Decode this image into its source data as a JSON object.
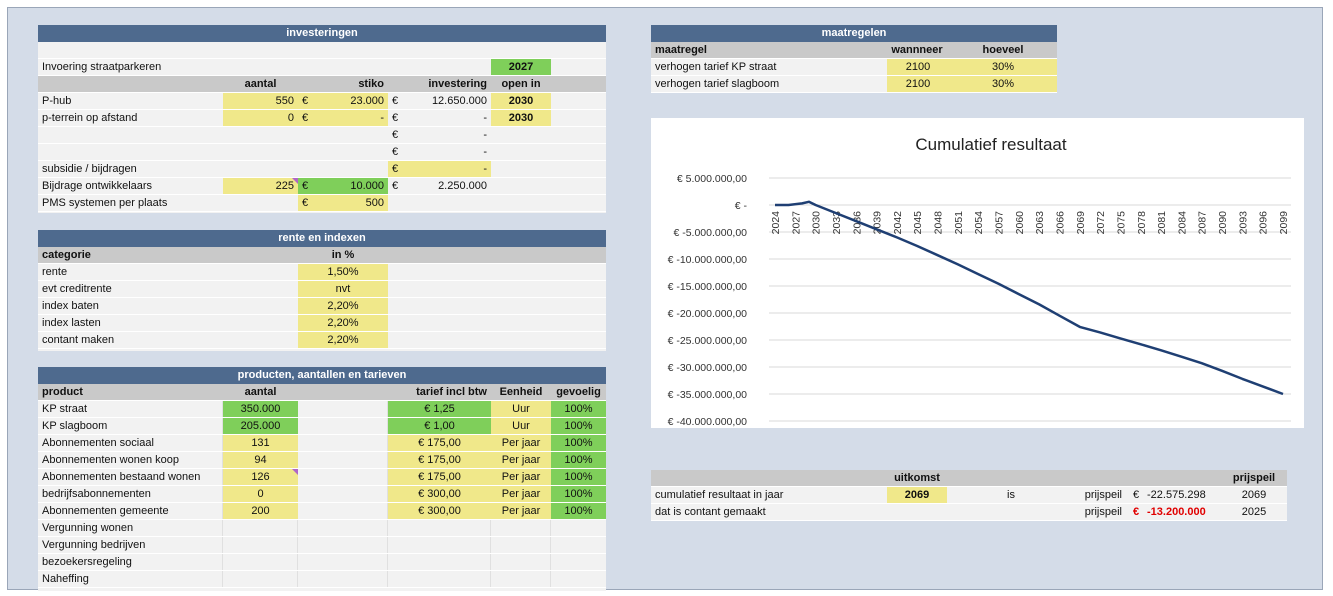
{
  "investeringen": {
    "title": "investeringen",
    "invoering_label": "Invoering straatparkeren",
    "invoering_year": "2027",
    "headers": [
      "aantal",
      "stiko",
      "investering",
      "open in"
    ],
    "rows": [
      {
        "label": "P-hub",
        "aantal": "550",
        "cur1": "€",
        "stiko": "23.000",
        "cur2": "€",
        "investering": "12.650.000",
        "open": "2030"
      },
      {
        "label": "p-terrein op afstand",
        "aantal": "0",
        "cur1": "€",
        "stiko": "-",
        "cur2": "€",
        "investering": "-",
        "open": "2030"
      },
      {
        "label": "",
        "cur2": "€",
        "investering": "-"
      },
      {
        "label": "",
        "cur2": "€",
        "investering": "-"
      },
      {
        "label": "subsidie / bijdragen",
        "cur2": "€",
        "investering": "-"
      },
      {
        "label": "Bijdrage ontwikkelaars",
        "aantal": "225",
        "cur1": "€",
        "stiko": "10.000",
        "cur2": "€",
        "investering": "2.250.000"
      },
      {
        "label": "PMS systemen per plaats",
        "cur1": "€",
        "stiko": "500"
      }
    ]
  },
  "rente": {
    "title": "rente en indexen",
    "headers": [
      "categorie",
      "in %"
    ],
    "rows": [
      {
        "label": "rente",
        "value": "1,50%"
      },
      {
        "label": "evt creditrente",
        "value": "nvt"
      },
      {
        "label": "index baten",
        "value": "2,20%"
      },
      {
        "label": "index lasten",
        "value": "2,20%"
      },
      {
        "label": "contant maken",
        "value": "2,20%"
      }
    ]
  },
  "producten": {
    "title": "producten, aantallen en tarieven",
    "headers": [
      "product",
      "aantal",
      "tarief incl btw",
      "Eenheid",
      "gevoelig"
    ],
    "rows": [
      {
        "product": "KP straat",
        "aantal": "350.000",
        "tarief": "€ 1,25",
        "eenheid": "Uur",
        "gevoelig": "100%"
      },
      {
        "product": "KP slagboom",
        "aantal": "205.000",
        "tarief": "€ 1,00",
        "eenheid": "Uur",
        "gevoelig": "100%"
      },
      {
        "product": "Abonnementen sociaal",
        "aantal": "131",
        "tarief": "€ 175,00",
        "eenheid": "Per jaar",
        "gevoelig": "100%"
      },
      {
        "product": "Abonnementen wonen koop",
        "aantal": "94",
        "tarief": "€ 175,00",
        "eenheid": "Per jaar",
        "gevoelig": "100%"
      },
      {
        "product": "Abonnementen bestaand wonen",
        "aantal": "126",
        "tarief": "€ 175,00",
        "eenheid": "Per jaar",
        "gevoelig": "100%"
      },
      {
        "product": "bedrijfsabonnementen",
        "aantal": "0",
        "tarief": "€ 300,00",
        "eenheid": "Per jaar",
        "gevoelig": "100%"
      },
      {
        "product": "Abonnementen gemeente",
        "aantal": "200",
        "tarief": "€ 300,00",
        "eenheid": "Per jaar",
        "gevoelig": "100%"
      },
      {
        "product": "Vergunning wonen"
      },
      {
        "product": "Vergunning bedrijven"
      },
      {
        "product": "bezoekersregeling"
      },
      {
        "product": "Naheffing"
      }
    ]
  },
  "maatregelen": {
    "title": "maatregelen",
    "headers": [
      "maatregel",
      "wannneer",
      "hoeveel"
    ],
    "rows": [
      {
        "label": "verhogen tarief KP straat",
        "wanneer": "2100",
        "hoeveel": "30%"
      },
      {
        "label": "verhogen tarief slagboom",
        "wanneer": "2100",
        "hoeveel": "30%"
      }
    ]
  },
  "uitkomst": {
    "header_uitkomst": "uitkomst",
    "header_prijspeil": "prijspeil",
    "rows": [
      {
        "label": "cumulatief resultaat in jaar",
        "year": "2069",
        "is": "is",
        "pp": "prijspeil",
        "cur": "€",
        "amount": "-22.575.298",
        "pp_year": "2069"
      },
      {
        "label": "dat is contant gemaakt",
        "pp": "prijspeil",
        "cur": "€",
        "amount": "-13.200.000",
        "pp_year": "2025"
      }
    ]
  },
  "chart_data": {
    "type": "line",
    "title": "Cumulatief resultaat",
    "y_ticks": [
      "€ 5.000.000,00",
      "€ -",
      "€ -5.000.000,00",
      "€ -10.000.000,00",
      "€ -15.000.000,00",
      "€ -20.000.000,00",
      "€ -25.000.000,00",
      "€ -30.000.000,00",
      "€ -35.000.000,00",
      "€ -40.000.000,00"
    ],
    "x_ticks": [
      "2024",
      "2027",
      "2030",
      "2033",
      "2036",
      "2039",
      "2042",
      "2045",
      "2048",
      "2051",
      "2054",
      "2057",
      "2060",
      "2063",
      "2066",
      "2069",
      "2072",
      "2075",
      "2078",
      "2081",
      "2084",
      "2087",
      "2090",
      "2093",
      "2096",
      "2099"
    ],
    "ylim": [
      -40000000,
      5000000
    ],
    "xlim": [
      2024,
      2099
    ],
    "color": "#1f3f73",
    "series": [
      {
        "x": [
          2024,
          2026,
          2028,
          2029,
          2030,
          2033,
          2036,
          2039,
          2042,
          2045,
          2048,
          2051,
          2054,
          2057,
          2060,
          2063,
          2066,
          2069,
          2072,
          2075,
          2078,
          2081,
          2084,
          2087,
          2090,
          2093,
          2096,
          2099
        ],
        "y": [
          0,
          0,
          300000,
          600000,
          0,
          -1500000,
          -3000000,
          -4500000,
          -6000000,
          -7600000,
          -9300000,
          -11000000,
          -12800000,
          -14600000,
          -16500000,
          -18400000,
          -20500000,
          -22575298,
          -23600000,
          -24700000,
          -25800000,
          -26900000,
          -28100000,
          -29300000,
          -30700000,
          -32200000,
          -33600000,
          -35000000
        ]
      }
    ]
  }
}
